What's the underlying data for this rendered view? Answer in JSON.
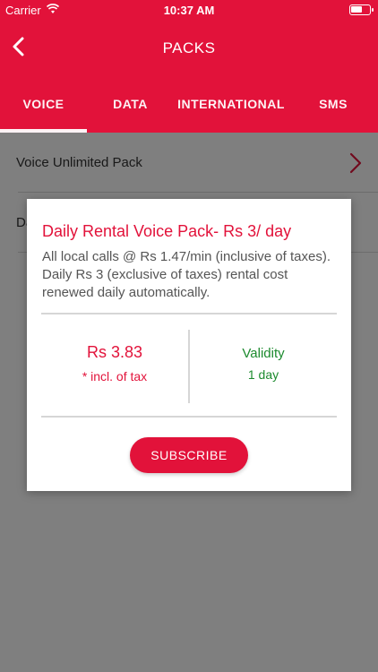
{
  "status_bar": {
    "carrier": "Carrier",
    "time": "10:37 AM"
  },
  "header": {
    "title": "PACKS",
    "back_icon": "chevron-left-icon"
  },
  "tabs": [
    {
      "label": "VOICE",
      "active": true
    },
    {
      "label": "DATA",
      "active": false
    },
    {
      "label": "INTERNATIONAL",
      "active": false
    },
    {
      "label": "SMS",
      "active": false
    }
  ],
  "list": {
    "items": [
      {
        "label": "Voice Unlimited Pack"
      },
      {
        "label": "Da"
      }
    ]
  },
  "modal": {
    "title": "Daily Rental Voice Pack- Rs 3/ day",
    "description": "All local calls @ Rs 1.47/min (inclusive of taxes). Daily Rs 3 (exclusive of taxes) rental cost renewed daily automatically.",
    "price": "Rs 3.83",
    "price_note": "* incl. of tax",
    "validity_label": "Validity",
    "validity_value": "1 day",
    "subscribe_label": "SUBSCRIBE"
  },
  "colors": {
    "brand": "#e2123a",
    "validity": "#1c8a2e"
  }
}
